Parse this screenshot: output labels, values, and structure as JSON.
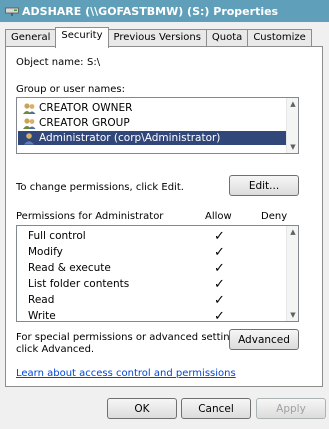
{
  "window": {
    "title": "ADSHARE (\\\\GOFASTBMW) (S:) Properties"
  },
  "tabs": [
    {
      "label": "General"
    },
    {
      "label": "Security"
    },
    {
      "label": "Previous Versions"
    },
    {
      "label": "Quota"
    },
    {
      "label": "Customize"
    }
  ],
  "security": {
    "object_name_label": "Object name:",
    "object_name_value": "S:\\",
    "group_label": "Group or user names:",
    "groups": [
      {
        "label": "CREATOR OWNER",
        "icon": "group-icon"
      },
      {
        "label": "CREATOR GROUP",
        "icon": "group-icon"
      },
      {
        "label": "Administrator (corp\\Administrator)",
        "icon": "user-icon",
        "selected": true
      }
    ],
    "change_perm_text": "To change permissions, click Edit.",
    "edit_button": "Edit...",
    "permissions_label": "Permissions for Administrator",
    "allow_header": "Allow",
    "deny_header": "Deny",
    "check_glyph": "✓",
    "permissions": [
      {
        "name": "Full control",
        "allow": true,
        "deny": false
      },
      {
        "name": "Modify",
        "allow": true,
        "deny": false
      },
      {
        "name": "Read & execute",
        "allow": true,
        "deny": false
      },
      {
        "name": "List folder contents",
        "allow": true,
        "deny": false
      },
      {
        "name": "Read",
        "allow": true,
        "deny": false
      },
      {
        "name": "Write",
        "allow": true,
        "deny": false
      }
    ],
    "special_text_line1": "For special permissions or advanced settings,",
    "special_text_line2": "click Advanced.",
    "advanced_button": "Advanced",
    "learn_link": "Learn about access control and permissions"
  },
  "footer": {
    "ok": "OK",
    "cancel": "Cancel",
    "apply": "Apply"
  },
  "colors": {
    "title_bar": "#5f9fb9",
    "selection": "#31477a",
    "link": "#0046d5"
  }
}
